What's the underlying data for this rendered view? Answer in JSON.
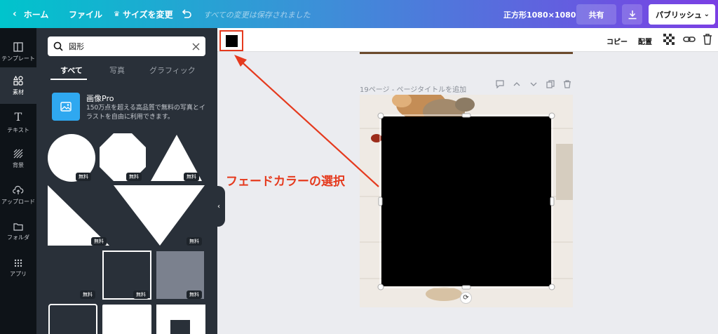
{
  "topbar": {
    "home": "ホーム",
    "file": "ファイル",
    "resize": "サイズを変更",
    "saved_status": "すべての変更は保存されました",
    "doc_size": "正方形1080×1080",
    "share": "共有",
    "publish": "パブリッシュ"
  },
  "rail": {
    "items": [
      {
        "label": "テンプレート",
        "icon": "template-icon"
      },
      {
        "label": "素材",
        "icon": "elements-icon"
      },
      {
        "label": "テキスト",
        "icon": "text-icon"
      },
      {
        "label": "背景",
        "icon": "background-icon"
      },
      {
        "label": "アップロード",
        "icon": "upload-icon"
      },
      {
        "label": "フォルダ",
        "icon": "folder-icon"
      },
      {
        "label": "アプリ",
        "icon": "apps-icon"
      }
    ]
  },
  "panel": {
    "search_value": "図形",
    "tabs": [
      "すべて",
      "写真",
      "グラフィック"
    ],
    "pro_title": "画像Pro",
    "pro_desc": "150万点を超える高品質で無料の写真とイラストを自由に利用できます。",
    "free_badge": "無料"
  },
  "toolbar": {
    "copy": "コピー",
    "arrange": "配置"
  },
  "page": {
    "label": "19ページ",
    "title_placeholder": " - ページタイトルを追加"
  },
  "annotation": {
    "text": "フェードカラーの選択",
    "color": "#e53a1e"
  },
  "colors": {
    "selected_fill": "#000000",
    "panel_bg": "#293039",
    "rail_bg": "#0e1318"
  }
}
